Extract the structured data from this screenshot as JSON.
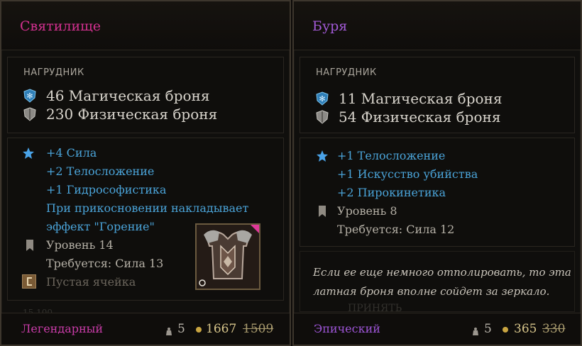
{
  "left": {
    "name": "Святилище",
    "name_color": "#d2308f",
    "slot": "НАГРУДНИК",
    "magic_armor": "46 Магическая броня",
    "physical_armor": "230 Физическая броня",
    "bonuses": [
      "+4 Сила",
      "+2 Телосложение",
      "+1 Гидрософистика"
    ],
    "effect_line1": "При прикосновении накладывает",
    "effect_line2": "эффект \"Горение\"",
    "level": "Уровень 14",
    "requirement": "Требуется: Сила 13",
    "rune_slot": "Пустая ячейка",
    "rarity": "Легендарный",
    "rarity_color": "#c93ca8",
    "weight": "5",
    "gold": "1667",
    "old_gold": "1509",
    "bg_numbers": "15     100"
  },
  "right": {
    "name": "Буря",
    "name_color": "#a35ad8",
    "slot": "НАГРУДНИК",
    "magic_armor": "11 Магическая броня",
    "physical_armor": "54 Физическая броня",
    "bonuses": [
      "+1 Телосложение",
      "+1 Искусство убийства",
      "+2 Пирокинетика"
    ],
    "level": "Уровень 8",
    "requirement": "Требуется: Сила 12",
    "description_line1": "Если ее еще немного отполировать, то эта",
    "description_line2": "латная броня вполне сойдет за зеркало.",
    "bg_text": "ПРИНЯТЬ",
    "rarity": "Эпический",
    "rarity_color": "#9d55d6",
    "weight": "5",
    "gold": "365",
    "old_gold": "330"
  },
  "icons": {
    "magic_armor": "magic-armor-icon",
    "physical_armor": "physical-armor-icon",
    "bonus": "star-icon",
    "level": "bookmark-icon",
    "rune": "rune-slot-icon",
    "weight": "weight-icon",
    "gold": "gold-coin-icon",
    "item": "chest-armor-item-icon"
  }
}
